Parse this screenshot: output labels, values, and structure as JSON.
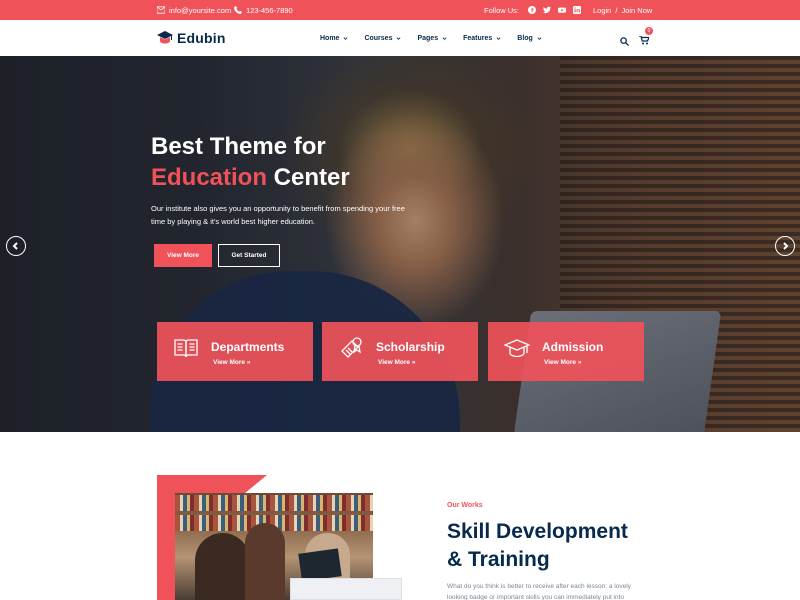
{
  "topbar": {
    "email": "info@yoursite.com",
    "phone": "123-456-7890",
    "follow_label": "Follow Us:",
    "social_icons": [
      "facebook-icon",
      "twitter-icon",
      "youtube-icon",
      "linkedin-icon"
    ],
    "login": "Login",
    "separator": "/",
    "join": "Join Now"
  },
  "nav": {
    "logo": "Edubin",
    "items": [
      {
        "label": "Home"
      },
      {
        "label": "Courses"
      },
      {
        "label": "Pages"
      },
      {
        "label": "Features"
      },
      {
        "label": "Blog"
      }
    ],
    "cart_count": "0"
  },
  "hero": {
    "title_line1": "Best Theme for",
    "title_accent": "Education",
    "title_rest": " Center",
    "description": "Our institute also gives you an opportunity to benefit from spending your free time by playing & it's world best higher education.",
    "btn_primary": "View More",
    "btn_secondary": "Get Started"
  },
  "features": [
    {
      "title": "Departments",
      "link": "View More »",
      "icon": "book-icon"
    },
    {
      "title": "Scholarship",
      "link": "View More »",
      "icon": "certificate-icon"
    },
    {
      "title": "Admission",
      "link": "View More »",
      "icon": "graduation-cap-icon"
    }
  ],
  "about": {
    "kicker": "Our Works",
    "title_line1": "Skill Development",
    "title_line2": "& Training",
    "text": "What do you think is better to receive after each lesson: a lovely looking badge or important skills you can immediately put into"
  },
  "colors": {
    "accent": "#f0525a",
    "navy": "#07294d"
  }
}
